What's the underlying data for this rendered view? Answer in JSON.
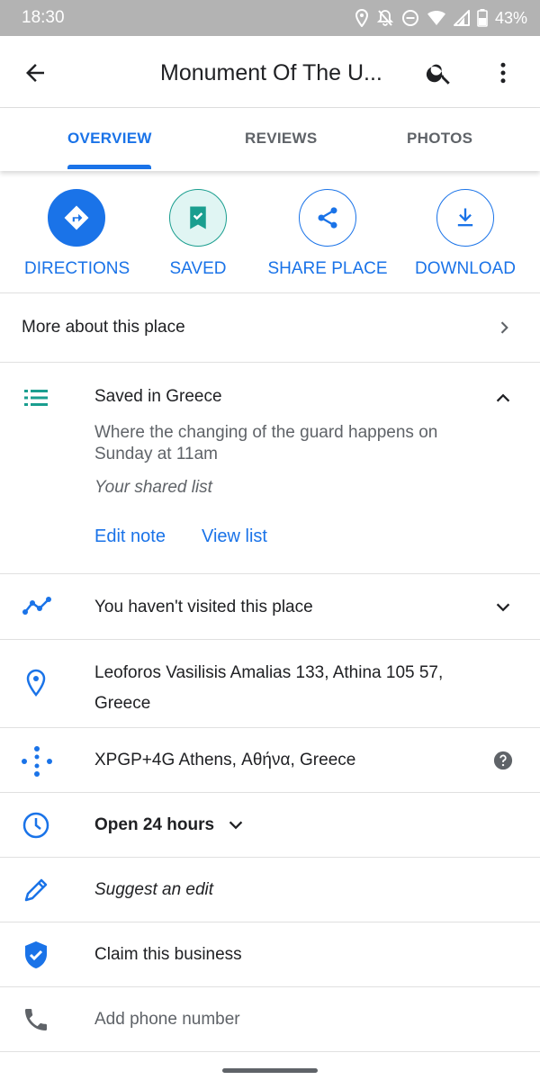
{
  "status_bar": {
    "time": "18:30",
    "battery": "43%",
    "icons": [
      "location-icon",
      "notifications-off-icon",
      "do-not-disturb-icon",
      "wifi-icon",
      "signal-icon",
      "battery-icon"
    ]
  },
  "app_bar": {
    "title": "Monument Of The U...",
    "icons": [
      "back-arrow-icon",
      "search-icon",
      "more-vert-icon"
    ]
  },
  "tabs": [
    "OVERVIEW",
    "REVIEWS",
    "PHOTOS"
  ],
  "actions": {
    "directions": "DIRECTIONS",
    "saved": "SAVED",
    "share": "SHARE PLACE",
    "download": "DOWNLOAD"
  },
  "more_about": "More about this place",
  "saved_list": {
    "title": "Saved in Greece",
    "note": "Where the changing of the guard happens on Sunday at 11am",
    "list_name": "Your shared list",
    "edit_note": "Edit note",
    "view_list": "View list"
  },
  "visited": "You haven't visited this place",
  "address": "Leoforos Vasilisis Amalias 133, Athina 105 57, Greece",
  "plus_code": "XPGP+4G Athens, Αθήνα, Greece",
  "hours": "Open 24 hours",
  "suggest_edit": "Suggest an edit",
  "claim_business": "Claim this business",
  "add_phone": "Add phone number",
  "colors": {
    "accent": "#1a73e8",
    "saved_teal": "#1a9e8f",
    "text_primary": "#202124",
    "text_secondary": "#5f6368",
    "status_bar": "#b3b3b3"
  }
}
